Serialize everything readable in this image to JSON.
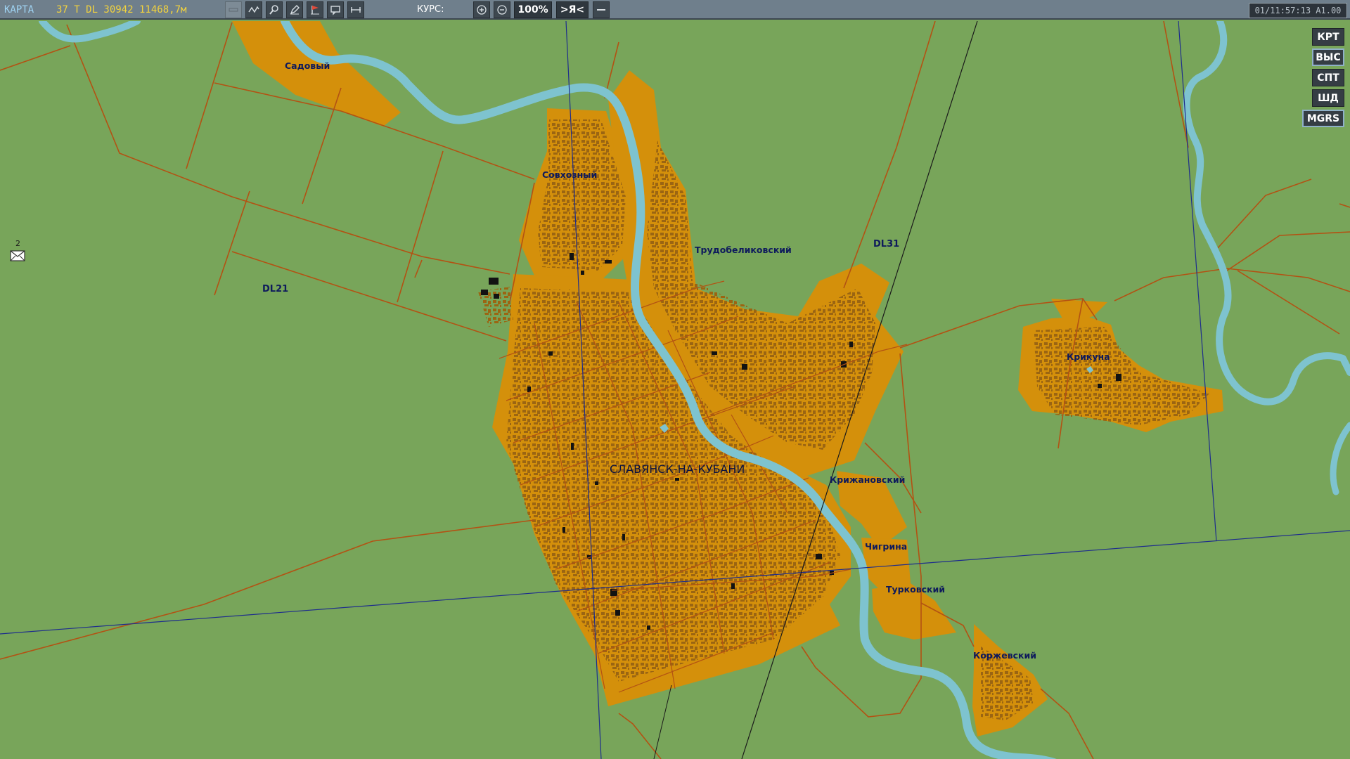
{
  "topbar": {
    "mode_label": "КАРТА",
    "coords": "37 T DL 30942 11468,7м",
    "course_label": "КУРС:",
    "zoom_level": "100%",
    "center_label": ">Я<",
    "datetime": "01/11:57:13 A1.00"
  },
  "side_buttons": [
    "КРТ",
    "ВЫС",
    "СПТ",
    "ШД",
    "MGRS"
  ],
  "messages": {
    "count": "2"
  },
  "map": {
    "city": "СЛАВЯНСК-НА-КУБАНИ",
    "places": {
      "sadovy": "Садовый",
      "sovkhozny": "Совхозный",
      "trudobelikovsky": "Трудобеликовский",
      "krikuna": "Крикуна",
      "krizhanovsky": "Крижановский",
      "chigrina": "Чигрина",
      "turkovsky": "Турковский",
      "korzhevsky": "Коржевский"
    },
    "grid": {
      "dl21": "DL21",
      "dl31": "DL31"
    }
  },
  "colors": {
    "land": "#78a55a",
    "urban": "#d4900b",
    "buildings": "#9b6512",
    "river": "#7ec3cf",
    "roads": "#b35213",
    "grid_lines": "#1e2d8c",
    "topbar": "#6f7f8c",
    "coord_text": "#f1d23e",
    "mode_text": "#9fd3f2"
  }
}
